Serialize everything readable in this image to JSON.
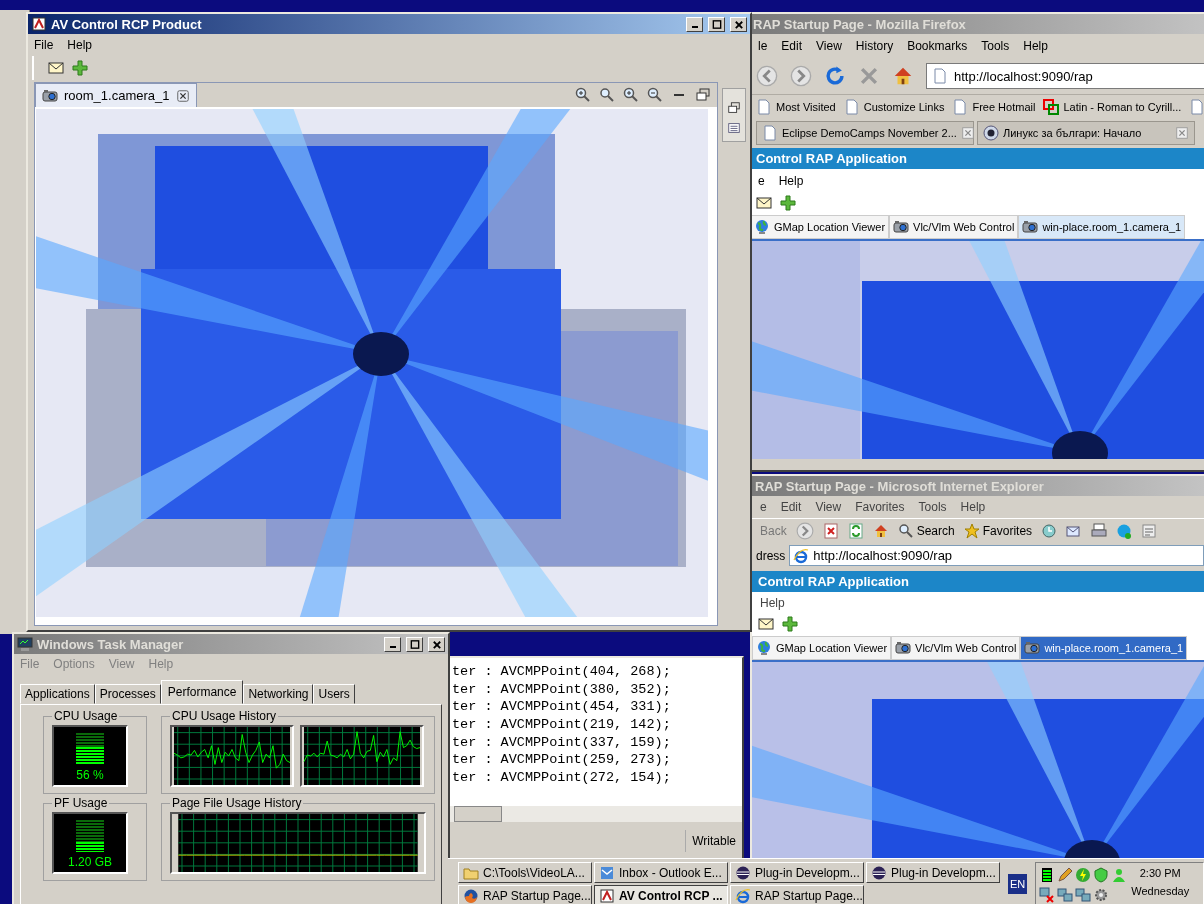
{
  "rcp_window": {
    "title": "AV Control RCP Product",
    "active": true,
    "menu": [
      "File",
      "Help"
    ],
    "view_tab": {
      "label": "room_1.camera_1",
      "selected": true
    },
    "video": {
      "kind": "picture"
    }
  },
  "firefox_window": {
    "title": "RAP Startup Page - Mozilla Firefox",
    "active": false,
    "menu": [
      "le",
      "Edit",
      "View",
      "History",
      "Bookmarks",
      "Tools",
      "Help"
    ],
    "address": "http://localhost:9090/rap",
    "bookmarks": [
      "Most Visited",
      "Customize Links",
      "Free Hotmail",
      "Latin - Roman to Cyrill..."
    ],
    "tabs": [
      {
        "label": "Eclipse DemoCamps November 2...",
        "selected": false
      },
      {
        "label": "Линукс за българи: Начало",
        "selected": false
      }
    ],
    "app": {
      "title": "Control RAP Application",
      "menu": [
        "e",
        "Help"
      ],
      "tabs": [
        {
          "label": "GMap Location Viewer",
          "selected": false
        },
        {
          "label": "Vlc/Vlm Web Control",
          "selected": false
        },
        {
          "label": "win-place.room_1.camera_1",
          "selected": true
        }
      ],
      "video": {
        "kind": "picture"
      }
    }
  },
  "ie_window": {
    "title": "RAP Startup Page - Microsoft Internet Explorer",
    "active": false,
    "menu": [
      "e",
      "Edit",
      "View",
      "Favorites",
      "Tools",
      "Help"
    ],
    "toolbar": [
      "Back",
      "Search",
      "Favorites"
    ],
    "address_label": "dress",
    "address": "http://localhost:9090/rap",
    "app": {
      "title": "Control RAP Application",
      "menu": [
        "Help"
      ],
      "tabs": [
        {
          "label": "GMap Location Viewer",
          "selected": false
        },
        {
          "label": "Vlc/Vlm Web Control",
          "selected": false
        },
        {
          "label": "win-place.room_1.camera_1",
          "selected": true
        }
      ],
      "video": {
        "kind": "picture"
      }
    }
  },
  "task_manager": {
    "title": "Windows Task Manager",
    "active": false,
    "menu": [
      "File",
      "Options",
      "View",
      "Help"
    ],
    "tabs": [
      {
        "label": "Applications",
        "selected": false
      },
      {
        "label": "Processes",
        "selected": false
      },
      {
        "label": "Performance",
        "selected": true
      },
      {
        "label": "Networking",
        "selected": false
      },
      {
        "label": "Users",
        "selected": false
      }
    ],
    "cpu_usage": {
      "label": "CPU Usage",
      "reading": "56 %",
      "level": 0.56
    },
    "cpu_history": {
      "label": "CPU Usage History"
    },
    "pf_usage": {
      "label": "PF Usage",
      "reading": "1.20 GB",
      "level": 0.3
    },
    "pf_history": {
      "label": "Page File Usage History"
    }
  },
  "code_editor": {
    "lines": [
      "ter : AVCMPPoint(404, 268);",
      "ter : AVCMPPoint(380, 352);",
      "ter : AVCMPPoint(454, 331);",
      "ter : AVCMPPoint(219, 142);",
      "ter : AVCMPPoint(337, 159);",
      "ter : AVCMPPoint(259, 273);",
      "ter : AVCMPPoint(272, 154);"
    ],
    "status": "Writable"
  },
  "taskbar": {
    "buttons": [
      {
        "label": "C:\\Tools\\VideoLA...",
        "selected": false
      },
      {
        "label": "Inbox - Outlook E...",
        "selected": false
      },
      {
        "label": "Plug-in Developm...",
        "selected": false
      },
      {
        "label": "Plug-in Developm...",
        "selected": false
      },
      {
        "label": "RAP Startup Page...",
        "selected": false
      },
      {
        "label": "AV Control RCP ...",
        "selected": true
      },
      {
        "label": "RAP Startup Page...",
        "selected": false
      }
    ],
    "language": "EN",
    "time": "2:30 PM",
    "day": "Wednesday"
  }
}
